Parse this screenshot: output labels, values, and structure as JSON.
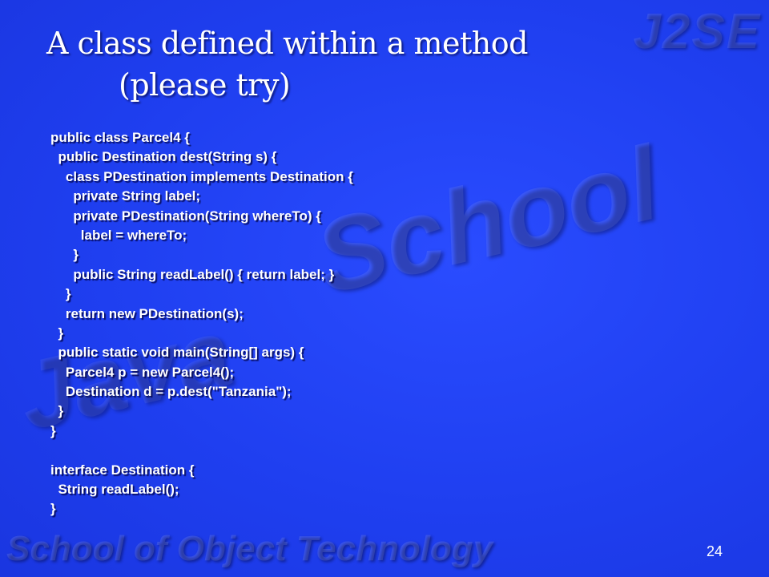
{
  "slide": {
    "title_line1": "A class defined within a method",
    "title_line2": "(please try)",
    "code_lines": [
      "public class Parcel4 {",
      "  public Destination dest(String s) {",
      "    class PDestination implements Destination {",
      "      private String label;",
      "      private PDestination(String whereTo) {",
      "        label = whereTo;",
      "      }",
      "      public String readLabel() { return label; }",
      "    }",
      "    return new PDestination(s);",
      "  }",
      "  public static void main(String[] args) {",
      "    Parcel4 p = new Parcel4();",
      "    Destination d = p.dest(\"Tanzania\");",
      "  }",
      "}",
      "",
      "interface Destination {",
      "  String readLabel();",
      "}"
    ],
    "page_number": "24"
  },
  "watermarks": {
    "corner_logo": "J2SE",
    "center_text": "School",
    "left_text": "Java",
    "footer_text": "School of Object Technology"
  },
  "colors": {
    "background": "#1f3ff0",
    "text": "#ffffff"
  }
}
